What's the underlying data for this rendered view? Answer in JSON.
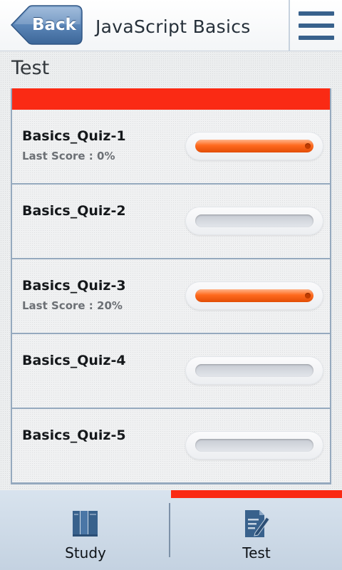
{
  "header": {
    "back_label": "Back",
    "title": "JavaScript Basics",
    "menu_icon": "hamburger-menu-icon"
  },
  "section": {
    "title": "Test"
  },
  "colors": {
    "accent": "#fa2a14",
    "primary_blue": "#38618c",
    "progress_orange": "#ff6a1e"
  },
  "quizzes": [
    {
      "name": "Basics_Quiz-1",
      "score_text": "Last Score : 0%",
      "has_score": true,
      "progress": 1.0
    },
    {
      "name": "Basics_Quiz-2",
      "score_text": "",
      "has_score": false,
      "progress": 0.0
    },
    {
      "name": "Basics_Quiz-3",
      "score_text": "Last Score : 20%",
      "has_score": true,
      "progress": 1.0
    },
    {
      "name": "Basics_Quiz-4",
      "score_text": "",
      "has_score": false,
      "progress": 0.0
    },
    {
      "name": "Basics_Quiz-5",
      "score_text": "",
      "has_score": false,
      "progress": 0.0
    }
  ],
  "bottom_nav": {
    "active": "test",
    "study": {
      "label": "Study",
      "icon": "book-icon"
    },
    "test": {
      "label": "Test",
      "icon": "test-edit-icon"
    }
  }
}
